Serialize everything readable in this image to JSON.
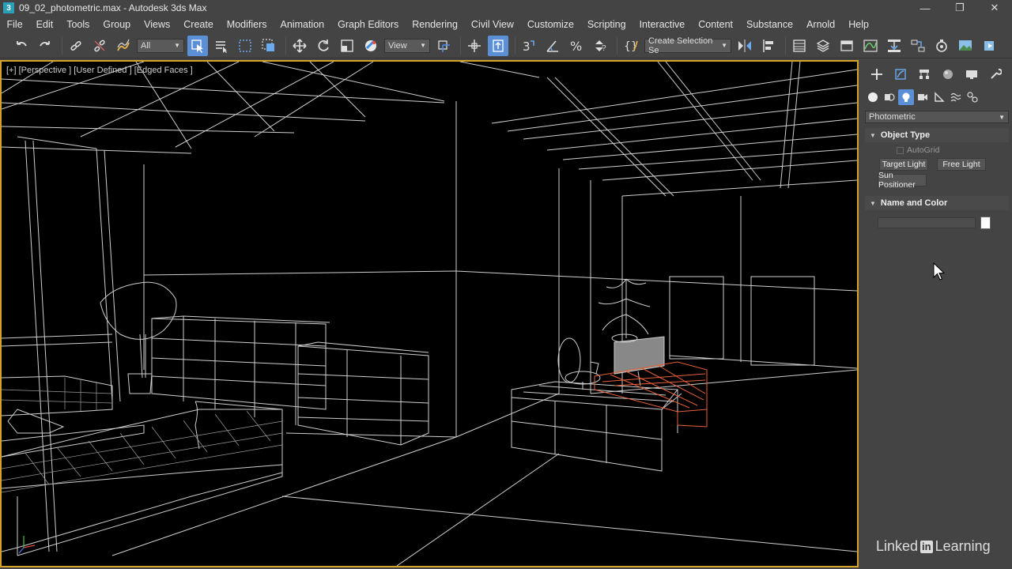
{
  "window": {
    "title": "09_02_photometric.max - Autodesk 3ds Max",
    "app_icon": "3",
    "controls": [
      "minimize-icon",
      "restore-icon",
      "close-icon"
    ]
  },
  "menu": {
    "items": [
      "File",
      "Edit",
      "Tools",
      "Group",
      "Views",
      "Create",
      "Modifiers",
      "Animation",
      "Graph Editors",
      "Rendering",
      "Civil View",
      "Customize",
      "Scripting",
      "Interactive",
      "Content",
      "Substance",
      "Arnold",
      "Help"
    ]
  },
  "toolbar": {
    "selection_filter": "All",
    "ref_coord": "View",
    "named_selection": "Create Selection Se"
  },
  "viewport": {
    "label": "[+] [Perspective ] [User Defined ] [Edged Faces ]",
    "border_color": "#d6a32a",
    "selected_color": "#e8603a"
  },
  "command_panel": {
    "category_dropdown": "Photometric",
    "object_type": {
      "title": "Object Type",
      "autogrid_label": "AutoGrid",
      "buttons": [
        "Target Light",
        "Free Light",
        "Sun Positioner"
      ]
    },
    "name_and_color": {
      "title": "Name and Color",
      "swatch_color": "#ffffff"
    }
  },
  "watermark": {
    "brand_a": "Linked",
    "brand_in": "in",
    "brand_b": "Learning"
  }
}
